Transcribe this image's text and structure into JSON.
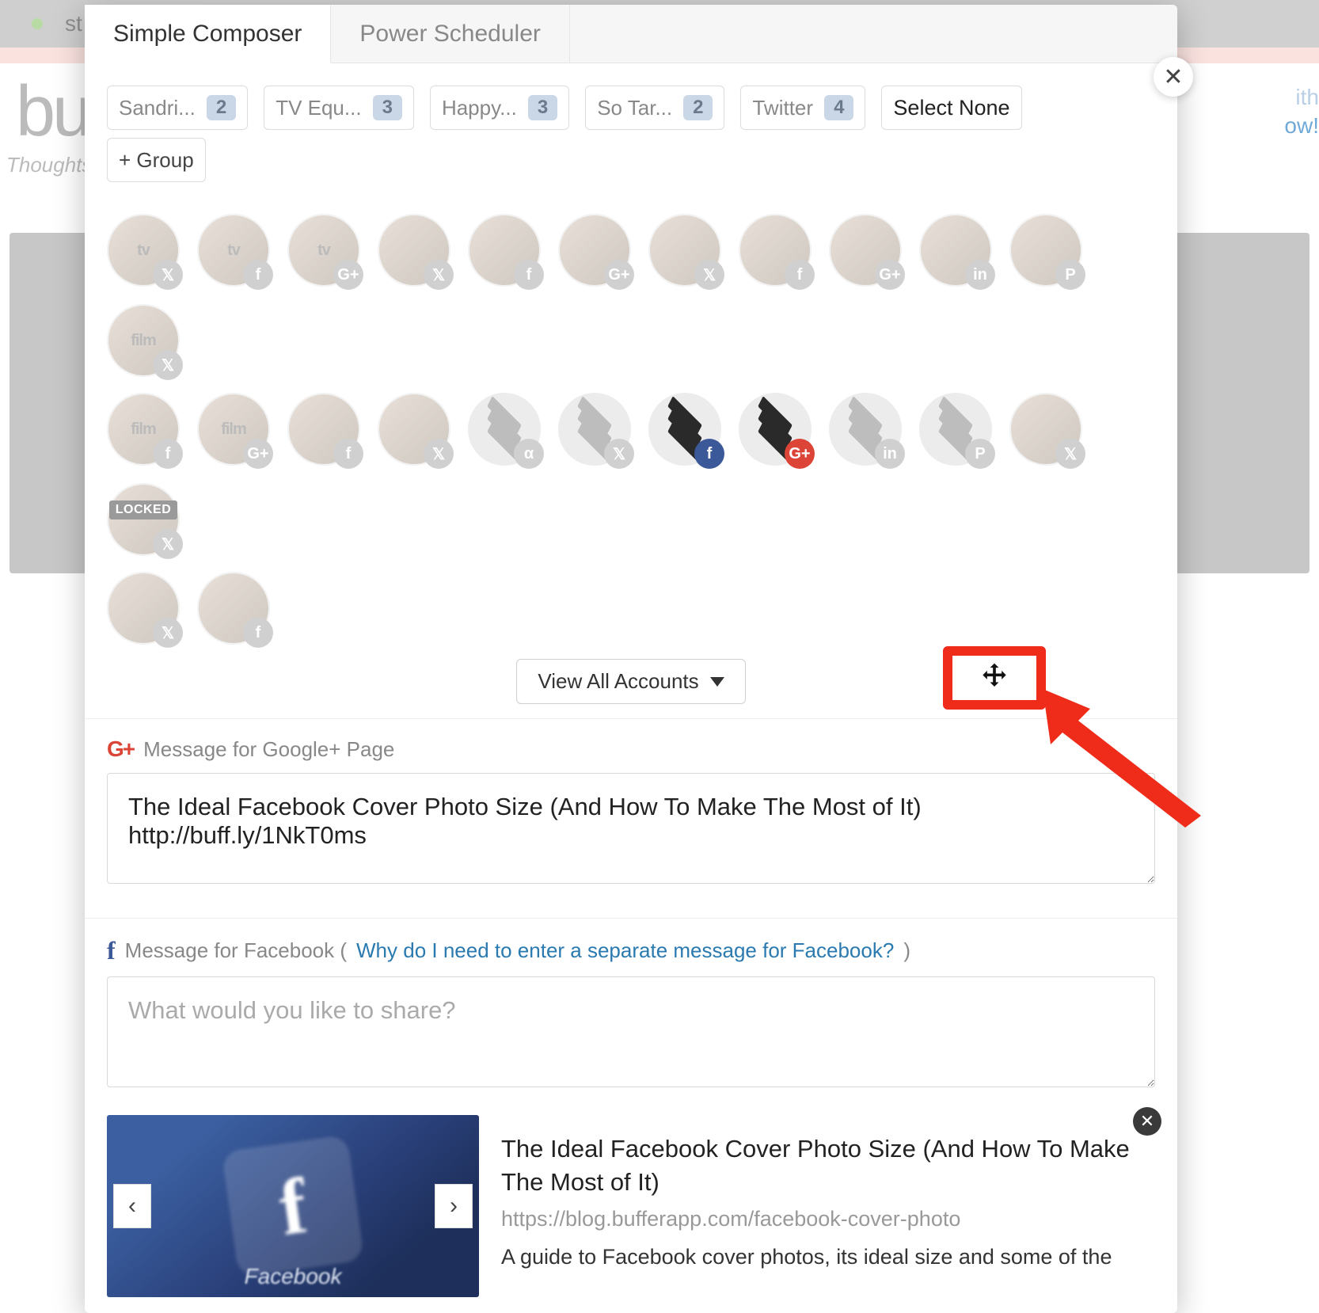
{
  "background": {
    "topbar_text": "st    S",
    "brand": "bu",
    "tagline": "Thoughts",
    "right_peek_1": "ith",
    "right_peek_2": "ow!"
  },
  "tabs": {
    "simple": "Simple Composer",
    "power": "Power Scheduler"
  },
  "close_glyph": "✕",
  "pills": [
    {
      "label": "Sandri...",
      "count": "2"
    },
    {
      "label": "TV Equ...",
      "count": "3"
    },
    {
      "label": "Happy...",
      "count": "3"
    },
    {
      "label": "So Tar...",
      "count": "2"
    },
    {
      "label": "Twitter",
      "count": "4"
    }
  ],
  "select_none": "Select None",
  "add_group": "+ Group",
  "accounts_row1": [
    {
      "type": "photo",
      "txt": "tv",
      "net": "tw"
    },
    {
      "type": "photo",
      "txt": "tv",
      "net": "fb"
    },
    {
      "type": "photo",
      "txt": "tv",
      "net": "gp"
    },
    {
      "type": "photo",
      "net": "tw"
    },
    {
      "type": "photo",
      "net": "fb"
    },
    {
      "type": "photo",
      "net": "gp"
    },
    {
      "type": "photo",
      "net": "tw"
    },
    {
      "type": "photo",
      "net": "fb"
    },
    {
      "type": "photo",
      "net": "gp"
    },
    {
      "type": "photo",
      "net": "in"
    },
    {
      "type": "photo",
      "net": "pi"
    },
    {
      "type": "photo",
      "txt": "film",
      "net": "tw"
    }
  ],
  "accounts_row2": [
    {
      "type": "photo",
      "txt": "film",
      "net": "fb"
    },
    {
      "type": "photo",
      "txt": "film",
      "net": "gp"
    },
    {
      "type": "photo",
      "net": "fb"
    },
    {
      "type": "photo",
      "net": "tw"
    },
    {
      "type": "stack",
      "net": "tw",
      "badge_glyph": "α"
    },
    {
      "type": "stack",
      "net": "tw"
    },
    {
      "type": "stack",
      "net": "fb",
      "selected": true
    },
    {
      "type": "stack",
      "net": "gp",
      "selected": true
    },
    {
      "type": "stack",
      "net": "in"
    },
    {
      "type": "stack",
      "net": "pi"
    },
    {
      "type": "photo",
      "net": "tw"
    },
    {
      "type": "photo",
      "net": "tw",
      "locked": "LOCKED"
    }
  ],
  "accounts_row3": [
    {
      "type": "photo",
      "net": "tw"
    },
    {
      "type": "photo",
      "net": "fb"
    }
  ],
  "view_all": "View All Accounts",
  "gp_section": {
    "label": "Message for Google+ Page",
    "value": "The Ideal Facebook Cover Photo Size (And How To Make The Most of It) http://buff.ly/1NkT0ms"
  },
  "fb_section": {
    "label_prefix": "Message for Facebook (",
    "link": "Why do I need to enter a separate message for Facebook?",
    "label_suffix": ")",
    "placeholder": "What would you like to share?"
  },
  "preview": {
    "title": "The Ideal Facebook Cover Photo Size (And How To Make The Most of It)",
    "url": "https://blog.bufferapp.com/facebook-cover-photo",
    "desc": "A guide to Facebook cover photos, its ideal size and some of the",
    "thumb_caption": "Facebook",
    "prev_glyph": "‹",
    "next_glyph": "›",
    "remove_glyph": "✕"
  }
}
